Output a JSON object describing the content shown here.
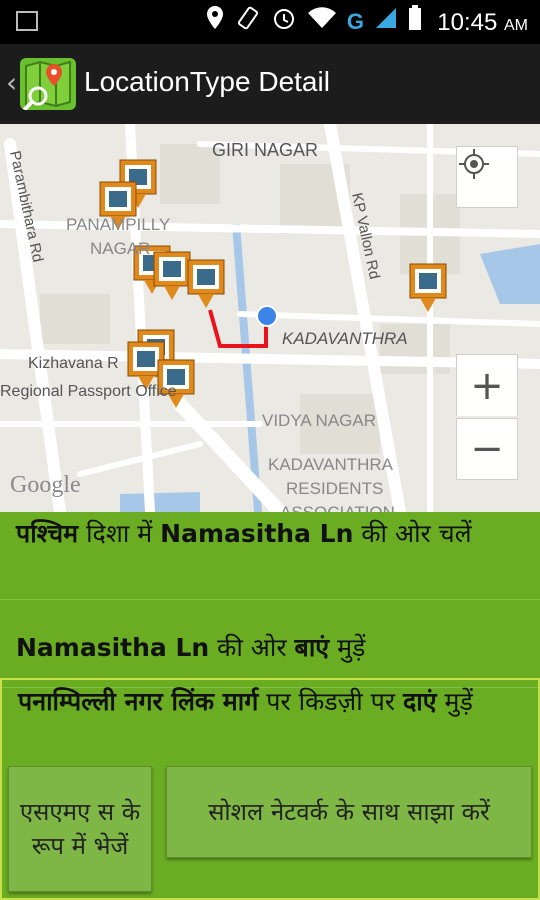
{
  "status_bar": {
    "time": "10:45",
    "ampm": "AM",
    "network_label": "G",
    "icons": [
      "image-icon",
      "location-pin-icon",
      "rotate-icon",
      "alarm-icon",
      "wifi-icon",
      "signal-icon",
      "battery-icon"
    ]
  },
  "app_bar": {
    "title": "LocationType Detail",
    "back_glyph": "‹"
  },
  "map": {
    "labels": {
      "giri_nagar": "GIRI NAGAR",
      "panampilly_1": "PANAMPILLY",
      "panampilly_2": "NAGAR",
      "parambithara": "Parambithara Rd",
      "kp_vallon": "KP Vallon Rd",
      "kadavanthra": "KADAVANTHRA",
      "kizhavana": "Kizhavana R",
      "passport": "Regional Passport Office",
      "vidya_nagar": "VIDYA NAGAR",
      "res_1": "KADAVANTHRA",
      "res_2": "RESIDENTS",
      "res_3": "ASSOCIATION",
      "google": "Google"
    },
    "zoom_in": "+",
    "zoom_out": "−"
  },
  "directions": {
    "step1": {
      "bold1": "पश्चिम",
      "text1": " दिशा में ",
      "bold2": "Namasitha Ln",
      "text2": " की ओर चलें"
    },
    "step2": {
      "bold1": "Namasitha Ln",
      "text1": " की ओर ",
      "bold2": "बाएं",
      "text2": " मुड़ें"
    },
    "step3": {
      "bold1": "पनाम्पिल्ली नगर लिंक मार्ग",
      "text1": " पर किडज़ी पर ",
      "bold2": "दाएं",
      "text2": " मुड़ें"
    }
  },
  "buttons": {
    "send_sms": "एसएमए स के रूप में भेजें",
    "share_social": "सोशल नेटवर्क के साथ साझा करें"
  },
  "colors": {
    "green_panel": "#6aad22",
    "route": "#e8141c",
    "marker_orange": "#e08a1e",
    "location_dot": "#3b84e8"
  }
}
